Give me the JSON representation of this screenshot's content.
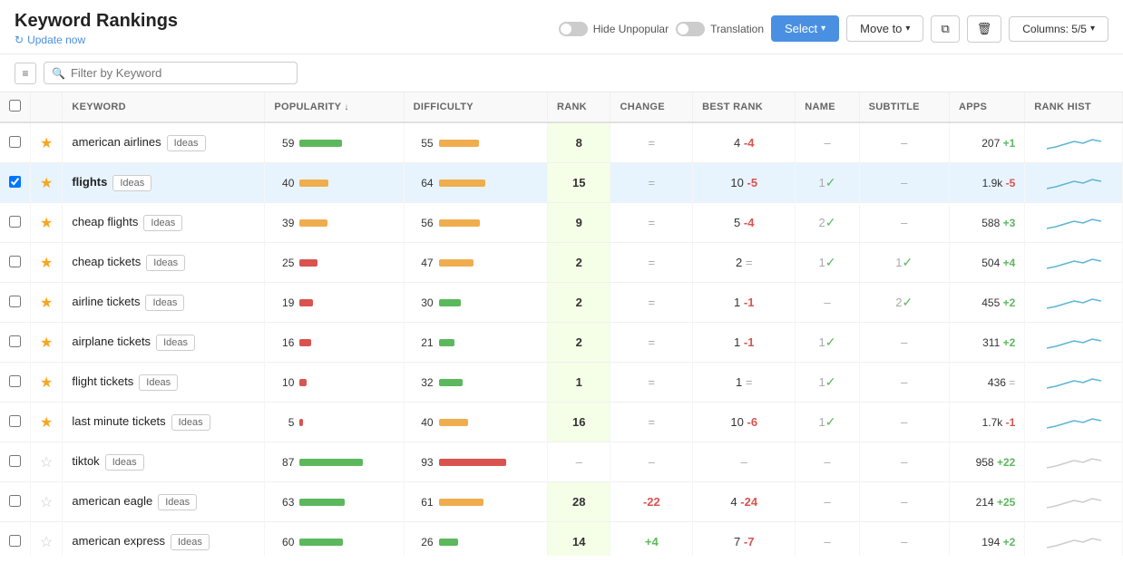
{
  "header": {
    "title": "Keyword Rankings",
    "update_label": "Update now",
    "controls": {
      "hide_unpopular_label": "Hide Unpopular",
      "translation_label": "Translation",
      "select_label": "Select",
      "move_to_label": "Move to",
      "columns_label": "Columns: 5/5"
    }
  },
  "toolbar": {
    "filter_placeholder": "Filter by Keyword"
  },
  "table": {
    "columns": [
      "",
      "",
      "KEYWORD",
      "POPULARITY",
      "DIFFICULTY",
      "RANK",
      "CHANGE",
      "BEST RANK",
      "NAME",
      "SUBTITLE",
      "APPS",
      "RANK HIST"
    ],
    "rows": [
      {
        "checked": false,
        "starred": true,
        "keyword": "american airlines",
        "tag": "Ideas",
        "pop_val": 59,
        "pop_bar": 45,
        "pop_color": "green",
        "diff_val": 55,
        "diff_bar": 55,
        "diff_color": "orange",
        "rank": "8",
        "rank_has_bg": true,
        "change": "=",
        "change_type": "neutral",
        "best_rank": "4",
        "best_rank_change": "-4",
        "best_rank_neg": true,
        "name": "–",
        "name_check": false,
        "subtitle": "–",
        "subtitle_check": false,
        "apps": "207",
        "apps_change": "+1",
        "apps_pos": true
      },
      {
        "checked": true,
        "starred": true,
        "keyword": "flights",
        "tag": "Ideas",
        "pop_val": 40,
        "pop_bar": 30,
        "pop_color": "orange",
        "diff_val": 64,
        "diff_bar": 64,
        "diff_color": "orange",
        "rank": "15",
        "rank_has_bg": true,
        "change": "=",
        "change_type": "neutral",
        "best_rank": "10",
        "best_rank_change": "-5",
        "best_rank_neg": true,
        "name": "1",
        "name_check": true,
        "subtitle": "–",
        "subtitle_check": false,
        "apps": "1.9k",
        "apps_change": "-5",
        "apps_pos": false
      },
      {
        "checked": false,
        "starred": true,
        "keyword": "cheap flights",
        "tag": "Ideas",
        "pop_val": 39,
        "pop_bar": 28,
        "pop_color": "orange",
        "diff_val": 56,
        "diff_bar": 56,
        "diff_color": "orange",
        "rank": "9",
        "rank_has_bg": true,
        "change": "=",
        "change_type": "neutral",
        "best_rank": "5",
        "best_rank_change": "-4",
        "best_rank_neg": true,
        "name": "2",
        "name_check": true,
        "subtitle": "–",
        "subtitle_check": false,
        "apps": "588",
        "apps_change": "+3",
        "apps_pos": true
      },
      {
        "checked": false,
        "starred": true,
        "keyword": "cheap tickets",
        "tag": "Ideas",
        "pop_val": 25,
        "pop_bar": 18,
        "pop_color": "red",
        "diff_val": 47,
        "diff_bar": 47,
        "diff_color": "orange",
        "rank": "2",
        "rank_has_bg": true,
        "change": "=",
        "change_type": "neutral",
        "best_rank": "2",
        "best_rank_change": "=",
        "best_rank_neg": false,
        "name": "1",
        "name_check": true,
        "subtitle": "1",
        "subtitle_check": true,
        "apps": "504",
        "apps_change": "+4",
        "apps_pos": true
      },
      {
        "checked": false,
        "starred": true,
        "keyword": "airline tickets",
        "tag": "Ideas",
        "pop_val": 19,
        "pop_bar": 13,
        "pop_color": "red",
        "diff_val": 30,
        "diff_bar": 30,
        "diff_color": "green",
        "rank": "2",
        "rank_has_bg": true,
        "change": "=",
        "change_type": "neutral",
        "best_rank": "1",
        "best_rank_change": "-1",
        "best_rank_neg": true,
        "name": "–",
        "name_check": false,
        "subtitle": "2",
        "subtitle_check": true,
        "apps": "455",
        "apps_change": "+2",
        "apps_pos": true
      },
      {
        "checked": false,
        "starred": true,
        "keyword": "airplane tickets",
        "tag": "Ideas",
        "pop_val": 16,
        "pop_bar": 11,
        "pop_color": "red",
        "diff_val": 21,
        "diff_bar": 21,
        "diff_color": "green",
        "rank": "2",
        "rank_has_bg": true,
        "change": "=",
        "change_type": "neutral",
        "best_rank": "1",
        "best_rank_change": "-1",
        "best_rank_neg": true,
        "name": "1",
        "name_check": true,
        "subtitle": "–",
        "subtitle_check": false,
        "apps": "311",
        "apps_change": "+2",
        "apps_pos": true
      },
      {
        "checked": false,
        "starred": true,
        "keyword": "flight tickets",
        "tag": "Ideas",
        "pop_val": 10,
        "pop_bar": 7,
        "pop_color": "red",
        "diff_val": 32,
        "diff_bar": 32,
        "diff_color": "green",
        "rank": "1",
        "rank_has_bg": true,
        "change": "=",
        "change_type": "neutral",
        "best_rank": "1",
        "best_rank_change": "=",
        "best_rank_neg": false,
        "name": "1",
        "name_check": true,
        "subtitle": "–",
        "subtitle_check": false,
        "apps": "436",
        "apps_change": "=",
        "apps_pos": null
      },
      {
        "checked": false,
        "starred": true,
        "keyword": "last minute tickets",
        "tag": "Ideas",
        "pop_val": 5,
        "pop_bar": 3,
        "pop_color": "red",
        "diff_val": 40,
        "diff_bar": 40,
        "diff_color": "orange",
        "rank": "16",
        "rank_has_bg": true,
        "change": "=",
        "change_type": "neutral",
        "best_rank": "10",
        "best_rank_change": "-6",
        "best_rank_neg": true,
        "name": "1",
        "name_check": true,
        "subtitle": "–",
        "subtitle_check": false,
        "apps": "1.7k",
        "apps_change": "-1",
        "apps_pos": false
      },
      {
        "checked": false,
        "starred": false,
        "keyword": "tiktok",
        "tag": "Ideas",
        "pop_val": 87,
        "pop_bar": 70,
        "pop_color": "green",
        "diff_val": 93,
        "diff_bar": 93,
        "diff_color": "red",
        "rank": "–",
        "rank_has_bg": false,
        "change": "–",
        "change_type": "dash",
        "best_rank": "–",
        "best_rank_change": "",
        "best_rank_neg": false,
        "name": "–",
        "name_check": false,
        "subtitle": "–",
        "subtitle_check": false,
        "apps": "958",
        "apps_change": "+22",
        "apps_pos": true
      },
      {
        "checked": false,
        "starred": false,
        "keyword": "american eagle",
        "tag": "Ideas",
        "pop_val": 63,
        "pop_bar": 48,
        "pop_color": "green",
        "diff_val": 61,
        "diff_bar": 61,
        "diff_color": "orange",
        "rank": "28",
        "rank_has_bg": true,
        "change": "-22",
        "change_type": "neg",
        "best_rank": "4",
        "best_rank_change": "-24",
        "best_rank_neg": true,
        "name": "–",
        "name_check": false,
        "subtitle": "–",
        "subtitle_check": false,
        "apps": "214",
        "apps_change": "+25",
        "apps_pos": true
      },
      {
        "checked": false,
        "starred": false,
        "keyword": "american express",
        "tag": "Ideas",
        "pop_val": 60,
        "pop_bar": 45,
        "pop_color": "green",
        "diff_val": 26,
        "diff_bar": 26,
        "diff_color": "green",
        "rank": "14",
        "rank_has_bg": true,
        "change": "+4",
        "change_type": "pos",
        "best_rank": "7",
        "best_rank_change": "-7",
        "best_rank_neg": true,
        "name": "–",
        "name_check": false,
        "subtitle": "–",
        "subtitle_check": false,
        "apps": "194",
        "apps_change": "+2",
        "apps_pos": true
      }
    ]
  }
}
